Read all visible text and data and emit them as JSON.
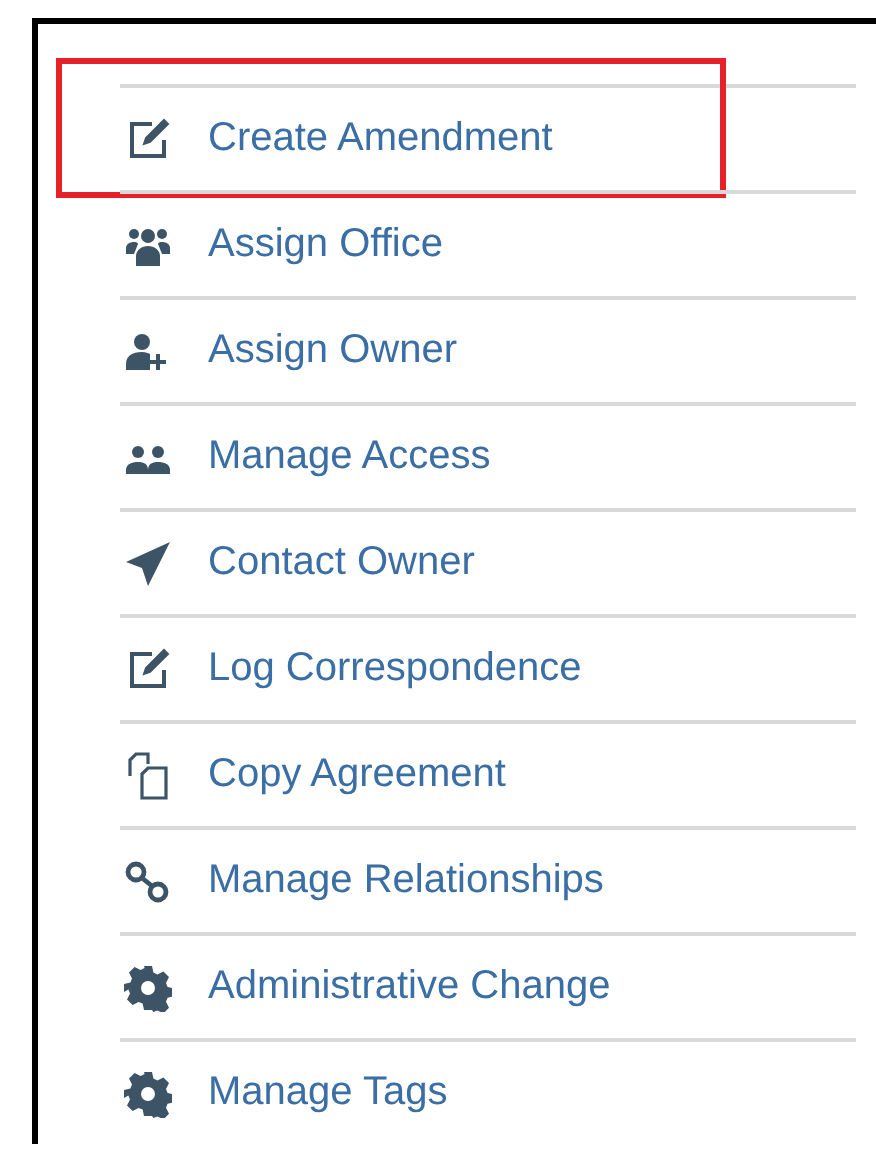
{
  "menu": {
    "items": [
      {
        "label": "Create Amendment",
        "highlighted": true
      },
      {
        "label": "Assign Office",
        "highlighted": false
      },
      {
        "label": "Assign Owner",
        "highlighted": false
      },
      {
        "label": "Manage Access",
        "highlighted": false
      },
      {
        "label": "Contact Owner",
        "highlighted": false
      },
      {
        "label": "Log Correspondence",
        "highlighted": false
      },
      {
        "label": "Copy Agreement",
        "highlighted": false
      },
      {
        "label": "Manage Relationships",
        "highlighted": false
      },
      {
        "label": "Administrative Change",
        "highlighted": false
      },
      {
        "label": "Manage Tags",
        "highlighted": false
      }
    ]
  }
}
